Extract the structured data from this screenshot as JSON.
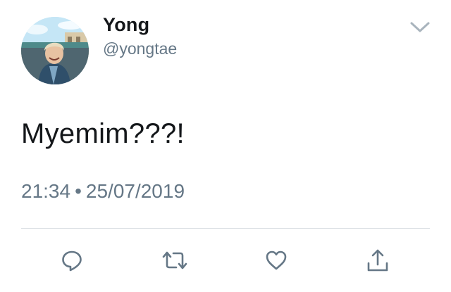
{
  "tweet": {
    "display_name": "Yong",
    "handle": "@yongtae",
    "text": "Myemim???!",
    "time": "21:34",
    "separator": "•",
    "date": "25/07/2019"
  },
  "icons": {
    "options": "chevron-down-icon",
    "reply": "reply-icon",
    "retweet": "retweet-icon",
    "like": "heart-icon",
    "share": "share-icon"
  },
  "colors": {
    "text_primary": "#14171a",
    "text_secondary": "#657786",
    "icon": "#657786",
    "divider": "#d9dee2"
  }
}
